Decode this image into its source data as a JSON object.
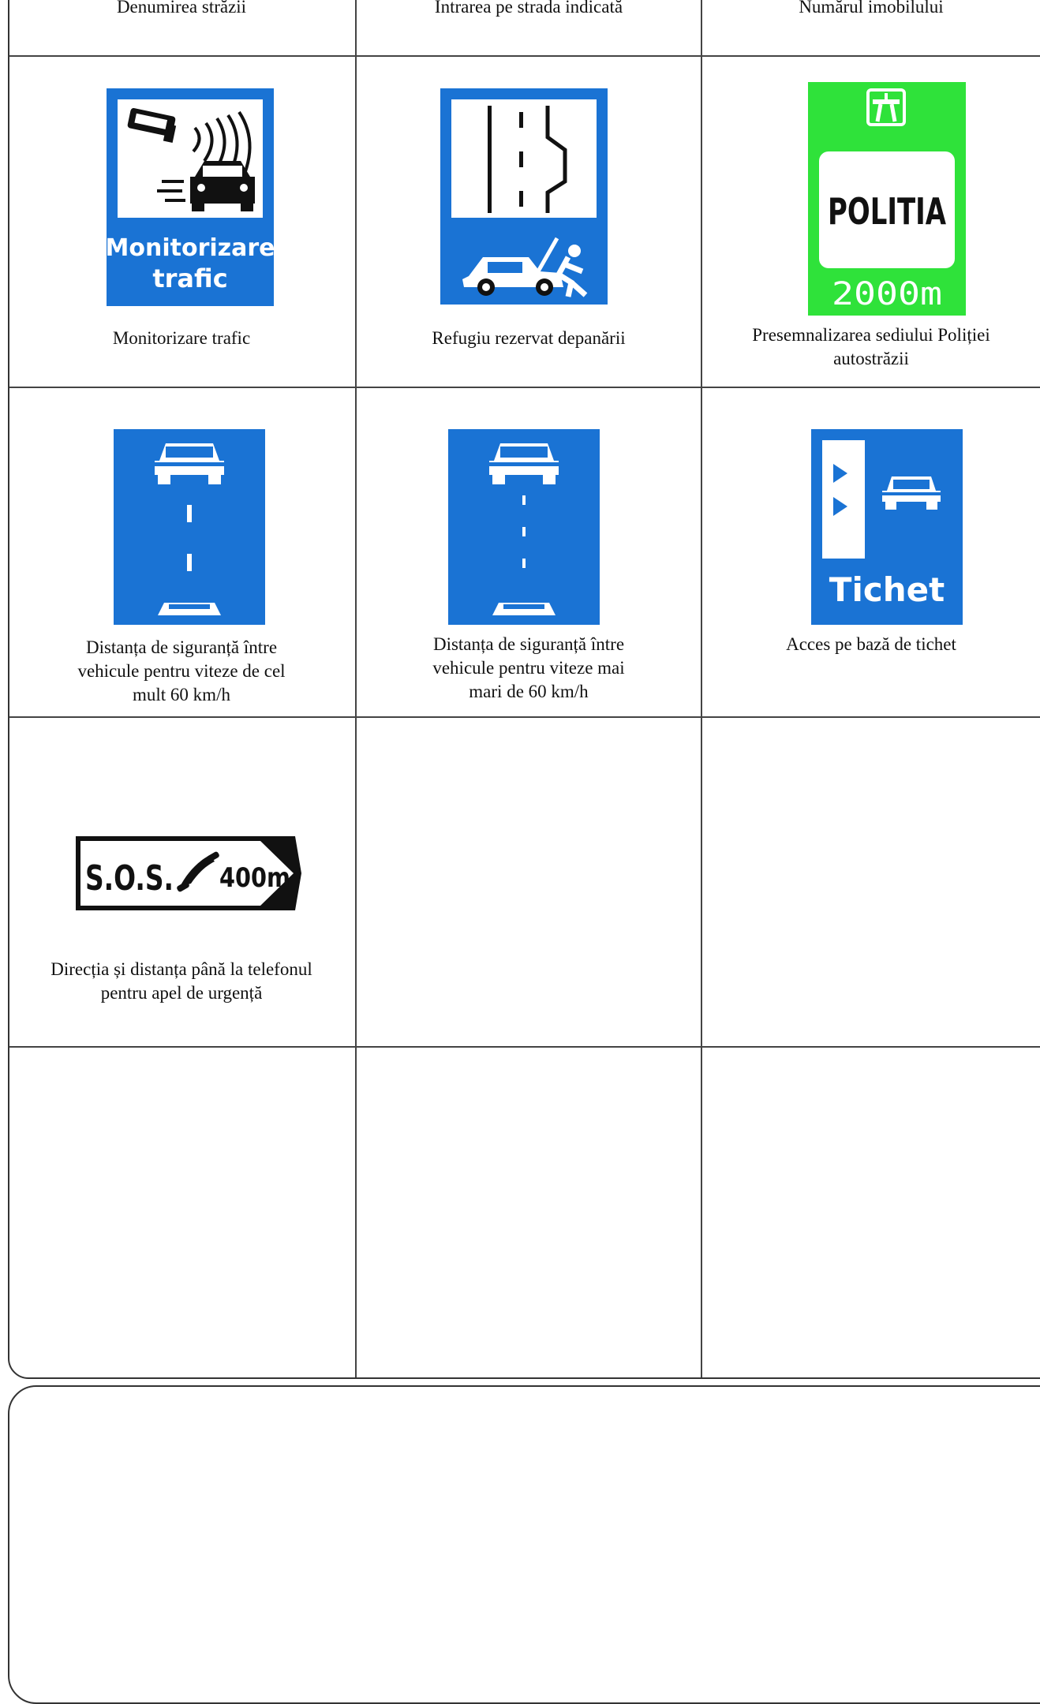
{
  "row0": {
    "c1": "Denumirea străzii",
    "c2": "Intrarea pe strada indicată",
    "c3": "Numărul imobilului"
  },
  "row1": {
    "c1": {
      "caption": "Monitorizare trafic",
      "sign_text_1": "Monitorizare",
      "sign_text_2": "trafic"
    },
    "c2": {
      "caption": "Refugiu rezervat depanării"
    },
    "c3": {
      "caption_1": "Presemnalizarea sediului Poliției",
      "caption_2": "autostrăzii",
      "sign_text": "POLITIA",
      "sign_distance": "2000m"
    }
  },
  "row2": {
    "c1": {
      "caption_1": "Distanța de siguranță între",
      "caption_2": "vehicule pentru viteze de cel",
      "caption_3": "mult 60 km/h"
    },
    "c2": {
      "caption_1": "Distanța de siguranță între",
      "caption_2": "vehicule pentru viteze mai",
      "caption_3": "mari de 60 km/h"
    },
    "c3": {
      "caption": "Acces pe  bază de tichet",
      "sign_text": "Tichet"
    }
  },
  "row3": {
    "c1": {
      "caption_1": "Direcția și distanța până la telefonul",
      "caption_2": "pentru apel de urgență",
      "sign_text": "S.O.S.",
      "sign_distance": "400m"
    }
  },
  "colors": {
    "blue": "#1a73d4",
    "green": "#2fe23a",
    "black": "#111111",
    "white": "#ffffff"
  }
}
